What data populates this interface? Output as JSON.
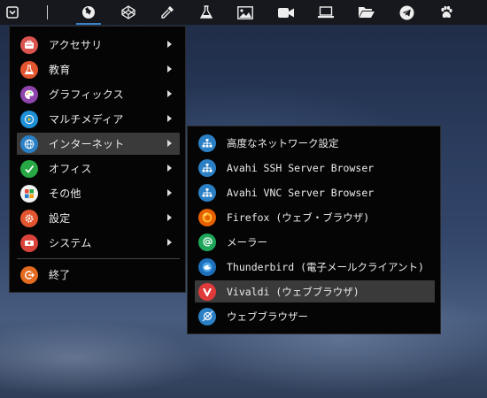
{
  "panel": {
    "launcher_icon": "menu-launcher-icon",
    "apps": [
      {
        "name": "browser-globe-icon",
        "active": true
      },
      {
        "name": "codepen-icon"
      },
      {
        "name": "color-picker-icon"
      },
      {
        "name": "flask-icon"
      },
      {
        "name": "image-viewer-icon"
      },
      {
        "name": "video-camera-icon"
      },
      {
        "name": "laptop-icon"
      },
      {
        "name": "folder-icon"
      },
      {
        "name": "telegram-icon"
      },
      {
        "name": "paw-icon"
      }
    ]
  },
  "main_menu": {
    "items": [
      {
        "label": "アクセサリ",
        "icon": "accessories-icon",
        "color": "#d9534f",
        "has_submenu": true
      },
      {
        "label": "教育",
        "icon": "education-flask-icon",
        "color": "#e2552e",
        "has_submenu": true
      },
      {
        "label": "グラフィックス",
        "icon": "graphics-palette-icon",
        "color": "#8e44ad",
        "has_submenu": true
      },
      {
        "label": "マルチメディア",
        "icon": "multimedia-icon",
        "color": "#1f8fd6",
        "has_submenu": true
      },
      {
        "label": "インターネット",
        "icon": "internet-globe-icon",
        "color": "#2b7fc4",
        "has_submenu": true,
        "highlighted": true
      },
      {
        "label": "オフィス",
        "icon": "office-check-icon",
        "color": "#27a844",
        "has_submenu": true
      },
      {
        "label": "その他",
        "icon": "other-grid-icon",
        "color": "#e74c3c",
        "has_submenu": true
      },
      {
        "label": "設定",
        "icon": "settings-gear-icon",
        "color": "#e2552e",
        "has_submenu": true
      },
      {
        "label": "システム",
        "icon": "system-icon",
        "color": "#d9433b",
        "has_submenu": true
      }
    ],
    "exit": {
      "label": "終了",
      "icon": "exit-power-icon",
      "color": "#e46a1f"
    }
  },
  "internet_submenu": {
    "items": [
      {
        "label": "高度なネットワーク設定",
        "icon": "network-settings-icon",
        "color": "#2b7fc4"
      },
      {
        "label": "Avahi SSH Server Browser",
        "icon": "avahi-ssh-icon",
        "color": "#2b7fc4"
      },
      {
        "label": "Avahi VNC Server Browser",
        "icon": "avahi-vnc-icon",
        "color": "#2b7fc4"
      },
      {
        "label": "Firefox (ウェブ・ブラウザ)",
        "icon": "firefox-icon",
        "color": "#e66000"
      },
      {
        "label": "メーラー",
        "icon": "mailer-at-icon",
        "color": "#1fa65a"
      },
      {
        "label": "Thunderbird (電子メールクライアント)",
        "icon": "thunderbird-icon",
        "color": "#1c6fb8"
      },
      {
        "label": "Vivaldi (ウェブブラウザ)",
        "icon": "vivaldi-icon",
        "color": "#e03a3a",
        "highlighted": true
      },
      {
        "label": "ウェブブラウザー",
        "icon": "web-browser-icon",
        "color": "#2b7fc4"
      }
    ]
  }
}
